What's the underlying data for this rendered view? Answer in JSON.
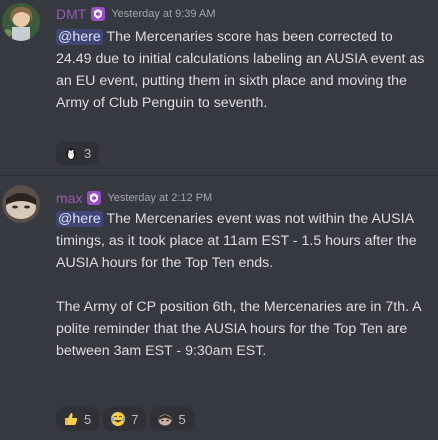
{
  "messages": [
    {
      "username": "DMT",
      "timestamp": "Yesterday at 9:39 AM",
      "mention": "@here",
      "paragraphs": [
        "The Mercenaries score has been corrected to 24.49 due to initial calculations labeling an AUSIA event as an EU event, putting them in sixth place and moving the Army of Club Penguin to seventh."
      ],
      "reactions": [
        {
          "emoji": "penguin-emoji",
          "count": "3"
        }
      ]
    },
    {
      "username": "max",
      "timestamp": "Yesterday at 2:12 PM",
      "mention": "@here",
      "paragraphs": [
        "The Mercenaries event was not within the AUSIA timings, as it took place at 11am EST - 1.5 hours after the AUSIA hours for the Top Ten ends.",
        "The Army of CP position 6th, the Mercenaries are in 7th. A polite reminder that the AUSIA hours for the Top Ten are between 3am EST - 9:30am EST."
      ],
      "reactions": [
        {
          "emoji": "thumbs-up-emoji",
          "count": "5"
        },
        {
          "emoji": "joy-emoji",
          "count": "7"
        },
        {
          "emoji": "custom-emoji",
          "count": "5"
        }
      ]
    }
  ],
  "colors": {
    "background": "#36393f",
    "username": "#9b59b6",
    "mention_bg": "#4a4f8c",
    "reaction_bg": "#2f3136"
  }
}
